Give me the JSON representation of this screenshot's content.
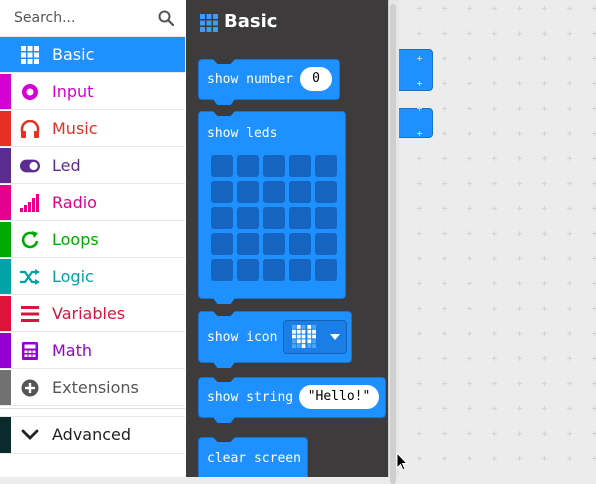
{
  "search": {
    "placeholder": "Search..."
  },
  "categories": [
    {
      "label": "Basic",
      "color": "#1e90ff",
      "icon": "grid-icon"
    },
    {
      "label": "Input",
      "color": "#d400d4",
      "icon": "target-icon"
    },
    {
      "label": "Music",
      "color": "#e63022",
      "icon": "headphones-icon"
    },
    {
      "label": "Led",
      "color": "#5c2d91",
      "icon": "toggle-icon"
    },
    {
      "label": "Radio",
      "color": "#e3008c",
      "icon": "signal-bars-icon"
    },
    {
      "label": "Loops",
      "color": "#00aa00",
      "icon": "loop-arrow-icon"
    },
    {
      "label": "Logic",
      "color": "#00a4a6",
      "icon": "shuffle-icon"
    },
    {
      "label": "Variables",
      "color": "#dc143c",
      "icon": "list-lines-icon"
    },
    {
      "label": "Math",
      "color": "#9400d3",
      "icon": "calculator-icon"
    },
    {
      "label": "Extensions",
      "color": "#717171",
      "icon": "plus-circle-icon"
    },
    {
      "label": "Advanced",
      "color": "#0a2b2b",
      "icon": "chevron-down-icon"
    }
  ],
  "flyout": {
    "title": "Basic",
    "blocks": {
      "show_number": {
        "label": "show number",
        "value": "0"
      },
      "show_leds": {
        "label": "show leds"
      },
      "show_icon": {
        "label": "show icon"
      },
      "show_string": {
        "label": "show string",
        "value": "\"Hello!\""
      },
      "clear_screen": {
        "label": "clear screen"
      }
    }
  }
}
